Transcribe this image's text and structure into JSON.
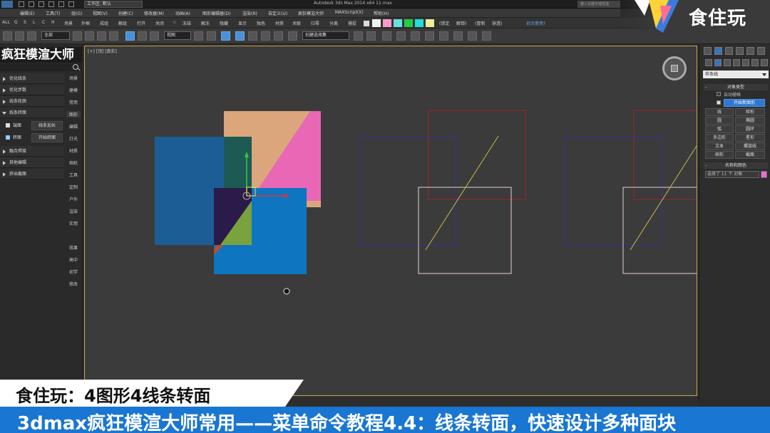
{
  "titlebar": {
    "workspace": "工作区: 默认",
    "app_title": "Autodesk 3ds Max  2014 x64    11.max",
    "search_placeholder": "键入关键字或短语"
  },
  "menubar": {
    "items": [
      "编辑(E)",
      "工具(T)",
      "组(G)",
      "视图(V)",
      "创建(C)",
      "修改器(M)",
      "动画(A)",
      "图形编辑器(D)",
      "渲染(R)",
      "自定义(U)",
      "疯狂模渲大师",
      "MAXScript(X)",
      "帮助(H)"
    ]
  },
  "ribbon": {
    "left_labels": [
      "ALL",
      "G",
      "S",
      "L",
      "C",
      "H"
    ],
    "items": [
      "场景",
      "外框",
      "成组",
      "解组",
      "打开",
      "关闭",
      "☆",
      "冻结",
      "解冻",
      "隐藏",
      "显示",
      "独色",
      "材质",
      "关联",
      "归零",
      "分离",
      "捕捉"
    ],
    "right_items": [
      "(锁定",
      "解锁)",
      "(冒制",
      "穿透)",
      "初次使用?"
    ],
    "swatch_colors": [
      "#f2f2f2",
      "#ff99cc",
      "#66e0e0",
      "#22cc44",
      "#22dddd",
      "#eeee99"
    ]
  },
  "toolbar": {
    "selection_filter": "全部",
    "reference_coord": "视图",
    "named_selection": "创建选择集"
  },
  "leftpanel": {
    "title": "疯狂模渲大师",
    "sections": [
      {
        "label": "优化线条",
        "open": false
      },
      {
        "label": "优化步数",
        "open": false
      },
      {
        "label": "线条轮廓",
        "open": false
      },
      {
        "label": "线条转面",
        "open": true
      },
      {
        "label": "融合焊接",
        "open": false
      },
      {
        "label": "其他编辑",
        "open": false
      },
      {
        "label": "挤出截面",
        "open": false
      }
    ],
    "sub_options": {
      "cap_label": "端面",
      "extend_button": "线条加长",
      "convert_label": "转面",
      "convert_button": "开始转面"
    },
    "side_tabs": [
      "场景",
      "建模",
      "常用",
      "图形",
      "编辑",
      "灯光",
      "材质",
      "相机",
      "工具",
      "定制",
      "户外",
      "渲染",
      "实用",
      "效果",
      "高中",
      "初学",
      "修改"
    ]
  },
  "viewport": {
    "label": "[+] [顶] [真实]"
  },
  "rightpanel": {
    "object_type_dropdown": "样条线",
    "object_type_header": "对象类型",
    "auto_grid": "自动栅格",
    "start_new_shape": "开始新图形",
    "shape_buttons": [
      "线",
      "矩形",
      "圆",
      "椭圆",
      "弧",
      "圆环",
      "多边形",
      "星形",
      "文本",
      "螺旋线",
      "卵形",
      "截面"
    ],
    "name_color_header": "名称和颜色",
    "name_field": "选择了 11 个 对象"
  },
  "brand": {
    "text": "食住玩"
  },
  "captions": {
    "line1": "食住玩：4图形4线条转面",
    "line2": "3dmax疯狂模渲大师常用——菜单命令教程4.4：线条转面，快速设计多种面块"
  }
}
